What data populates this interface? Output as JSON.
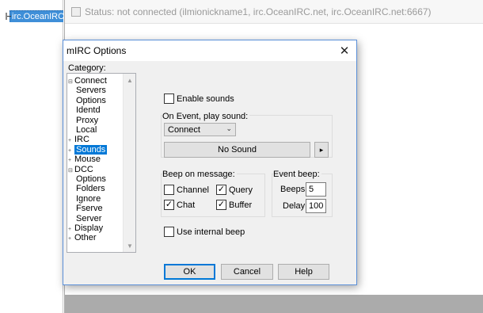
{
  "app": {
    "tree_item_label": "irc.OceanIRC...",
    "status_title": "Status: not connected (ilmionickname1, irc.OceanIRC.net, irc.OceanIRC.net:6667)"
  },
  "dialog": {
    "title": "mIRC Options",
    "category_label": "Category:",
    "categories": [
      {
        "label": "Connect",
        "expander": "⊟"
      },
      {
        "label": "Servers"
      },
      {
        "label": "Options"
      },
      {
        "label": "Identd"
      },
      {
        "label": "Proxy"
      },
      {
        "label": "Local"
      },
      {
        "label": "IRC",
        "expander": "+"
      },
      {
        "label": "Sounds",
        "expander": "+",
        "selected": true
      },
      {
        "label": "Mouse",
        "expander": "+"
      },
      {
        "label": "DCC",
        "expander": "⊟"
      },
      {
        "label": "Options"
      },
      {
        "label": "Folders"
      },
      {
        "label": "Ignore"
      },
      {
        "label": "Fserve"
      },
      {
        "label": "Server"
      },
      {
        "label": "Display",
        "expander": "+"
      },
      {
        "label": "Other",
        "expander": "+"
      }
    ],
    "enable_sounds": {
      "label": "Enable sounds",
      "checked": false
    },
    "on_event_label": "On Event, play sound:",
    "event_select": "Connect",
    "sound_button": "No Sound",
    "sound_more": "▸",
    "beep_message_label": "Beep on message:",
    "channel": {
      "label": "Channel",
      "checked": false
    },
    "query": {
      "label": "Query",
      "checked": true
    },
    "chat": {
      "label": "Chat",
      "checked": true
    },
    "buffer": {
      "label": "Buffer",
      "checked": true
    },
    "event_beep_label": "Event beep:",
    "beeps_label": "Beeps:",
    "beeps_value": "5",
    "delay_label": "Delay:",
    "delay_value": "100",
    "use_internal_beep": {
      "label": "Use internal beep",
      "checked": false
    },
    "ok": "OK",
    "cancel": "Cancel",
    "help": "Help",
    "close_glyph": "✕"
  },
  "colors": {
    "selection": "#0078d7",
    "dialog_bg": "#f0f0f0",
    "mdi_bg": "#ababab"
  }
}
